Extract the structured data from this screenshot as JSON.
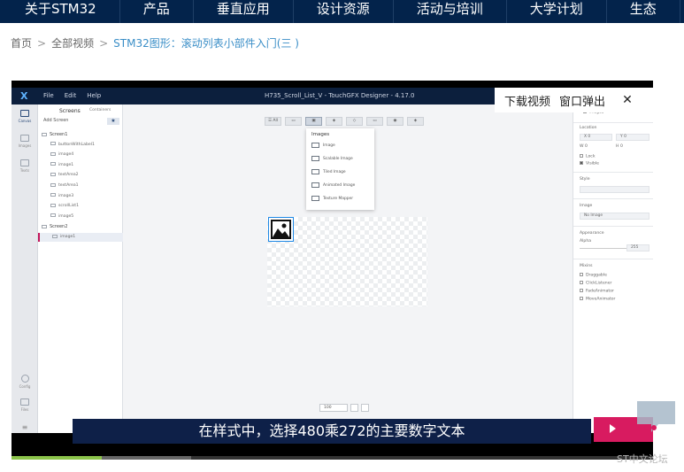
{
  "nav": {
    "items": [
      "关于STM32",
      "产品",
      "垂直应用",
      "设计资源",
      "活动与培训",
      "大学计划",
      "生态"
    ]
  },
  "breadcrumb": {
    "home": "首页",
    "videos": "全部视频",
    "current": "STM32图形：滚动列表小部件入门(三 )",
    "sep": ">"
  },
  "player": {
    "download_label": "下载视频",
    "popout_label": "窗口弹出",
    "close_symbol": "✕",
    "subtitle": "在样式中，选择480乘272的主要数字文本",
    "progress_fraction": 0.14,
    "buffer_fraction": 0.28
  },
  "app": {
    "title": "H735_Scroll_List_V - TouchGFX Designer - 4.17.0",
    "logo": "X",
    "menus": [
      "File",
      "Edit",
      "Help"
    ],
    "rail": [
      {
        "label": "Canvas",
        "icon": "canvas-icon"
      },
      {
        "label": "Images",
        "icon": "images-icon"
      },
      {
        "label": "Texts",
        "icon": "texts-icon"
      },
      {
        "label": "Config",
        "icon": "config-icon"
      },
      {
        "label": "Files",
        "icon": "files-icon"
      }
    ],
    "screens_panel": {
      "tab_screens": "Screens",
      "tab_containers": "Containers",
      "add_screen": "Add Screen",
      "add_symbol": "★",
      "tree": [
        {
          "label": "Screen1",
          "level": 0,
          "kind": "screen"
        },
        {
          "label": "buttonWithLabel1",
          "level": 1,
          "kind": "widget"
        },
        {
          "label": "image4",
          "level": 1,
          "kind": "widget"
        },
        {
          "label": "image1",
          "level": 1,
          "kind": "widget"
        },
        {
          "label": "textArea2",
          "level": 1,
          "kind": "widget"
        },
        {
          "label": "textArea1",
          "level": 1,
          "kind": "widget"
        },
        {
          "label": "image3",
          "level": 1,
          "kind": "widget"
        },
        {
          "label": "scrollList1",
          "level": 1,
          "kind": "widget"
        },
        {
          "label": "image5",
          "level": 1,
          "kind": "widget"
        },
        {
          "label": "Screen2",
          "level": 0,
          "kind": "screen"
        },
        {
          "label": "image1",
          "level": 1,
          "kind": "widget",
          "selected": true
        }
      ]
    },
    "toolbar": {
      "buttons": [
        "☰ All",
        "▭",
        "▣",
        "◈",
        "◇",
        "▭",
        "◉",
        "◈"
      ]
    },
    "dropdown": {
      "header": "Images",
      "items": [
        "Image",
        "Scalable Image",
        "Tiled Image",
        "Animated Image",
        "Texture Mapper"
      ]
    },
    "zoom": {
      "value": "100"
    },
    "properties": {
      "name_value": "image1",
      "location_header": "Location",
      "x_label": "X",
      "x_value": "0",
      "y_label": "Y",
      "y_value": "0",
      "w_label": "W",
      "w_value": "0",
      "h_label": "H",
      "h_value": "0",
      "lock_label": "Lock",
      "visible_label": "Visible",
      "style_header": "Style",
      "image_header": "Image",
      "image_value": "No Image",
      "appearance_header": "Appearance",
      "alpha_label": "Alpha",
      "alpha_value": "255",
      "mixins_header": "Mixins",
      "mixins": [
        "Draggable",
        "ClickListener",
        "FadeAnimator",
        "MoveAnimator"
      ]
    }
  },
  "watermark": "ST中文论坛",
  "colors": {
    "nav_bg": "#03234b",
    "link": "#3a8ec7",
    "subtitle_bg": "#0e2048",
    "accent_pink": "#d81b60",
    "progress": "#8bc34a",
    "selection": "#1e88e5"
  }
}
